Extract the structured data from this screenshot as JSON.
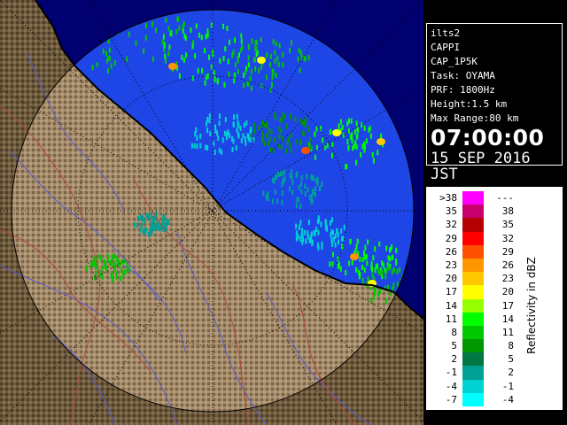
{
  "info": {
    "line1": "ilts2",
    "line2": "CAPPI",
    "line3": "CAP_1P5K",
    "line4": "Task: OYAMA",
    "line5": "PRF: 1800Hz",
    "line6": "Height:1.5 km",
    "line7": "Max Range:80 km",
    "time": "07:00:00",
    "date": "15 SEP 2016 JST"
  },
  "legend": {
    "title": "Reflectivity in dBZ",
    "rows": [
      {
        "lo": ">38",
        "hi": "---",
        "color": "#ff00ff"
      },
      {
        "lo": "35",
        "hi": "38",
        "color": "#c8006e"
      },
      {
        "lo": "32",
        "hi": "35",
        "color": "#b40000"
      },
      {
        "lo": "29",
        "hi": "32",
        "color": "#ff0000"
      },
      {
        "lo": "26",
        "hi": "29",
        "color": "#ff5000"
      },
      {
        "lo": "23",
        "hi": "26",
        "color": "#ff9600"
      },
      {
        "lo": "20",
        "hi": "23",
        "color": "#ffc800"
      },
      {
        "lo": "17",
        "hi": "20",
        "color": "#ffff00"
      },
      {
        "lo": "14",
        "hi": "17",
        "color": "#96ff00"
      },
      {
        "lo": "11",
        "hi": "14",
        "color": "#00ff00"
      },
      {
        "lo": "8",
        "hi": "11",
        "color": "#00c800"
      },
      {
        "lo": "5",
        "hi": "8",
        "color": "#009600"
      },
      {
        "lo": "2",
        "hi": "5",
        "color": "#007846"
      },
      {
        "lo": "-1",
        "hi": "2",
        "color": "#00a096"
      },
      {
        "lo": "-4",
        "hi": "-1",
        "color": "#00d2d2"
      },
      {
        "lo": "-7",
        "hi": "-4",
        "color": "#00ffff"
      }
    ]
  },
  "map": {
    "colors": {
      "land_outside": "#6e5a3c",
      "land_inside": "#9c8466",
      "sea_outside": "#000070",
      "sea_inside": "#1e46e6",
      "coastline": "#000000",
      "rivers": "#5a5ad2",
      "boundaries": "#b04a3a",
      "range_rings": "#000000"
    }
  }
}
